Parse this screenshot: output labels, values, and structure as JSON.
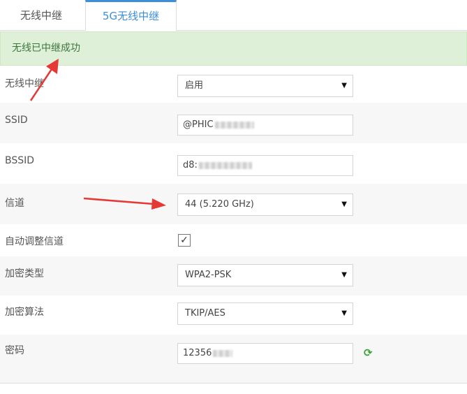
{
  "tabs": [
    {
      "label": "无线中继",
      "active": false
    },
    {
      "label": "5G无线中继",
      "active": true
    }
  ],
  "alert": {
    "message": "无线已中继成功"
  },
  "form": {
    "repeater": {
      "label": "无线中继",
      "value": "启用"
    },
    "ssid": {
      "label": "SSID",
      "value": "@PHIC"
    },
    "bssid": {
      "label": "BSSID",
      "value": "d8:"
    },
    "channel": {
      "label": "信道",
      "value": "44 (5.220 GHz)"
    },
    "auto_channel": {
      "label": "自动调整信道",
      "checked": true
    },
    "encryption_type": {
      "label": "加密类型",
      "value": "WPA2-PSK"
    },
    "encryption_algorithm": {
      "label": "加密算法",
      "value": "TKIP/AES"
    },
    "password": {
      "label": "密码",
      "value": "12356"
    }
  },
  "icons": {
    "select_caret": "triangle-down",
    "checkmark": "check",
    "refresh": "refresh-icon"
  },
  "colors": {
    "accent": "#3d8fd6",
    "alert_bg": "#dff0d8",
    "alert_text": "#3c763d",
    "arrow": "#e53935",
    "refresh": "#3aa13a"
  }
}
